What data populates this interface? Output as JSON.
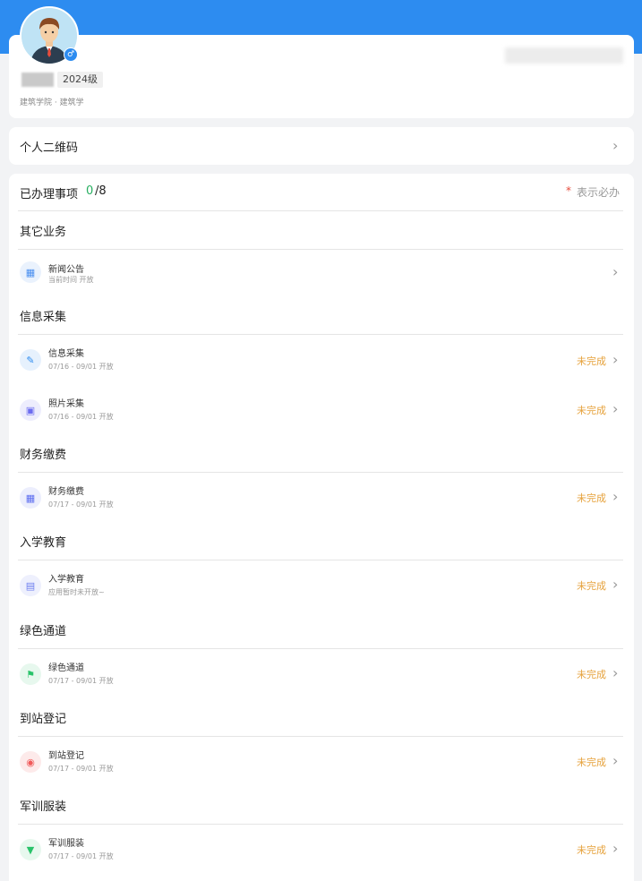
{
  "profile": {
    "grade": "2024级",
    "department": "建筑学院 · 建筑学",
    "gender_symbol": "♂"
  },
  "qr": {
    "label": "个人二维码"
  },
  "tasks": {
    "title": "已办理事项",
    "done": "0",
    "total": "/8",
    "required_mark": "*",
    "required_note": "表示必办"
  },
  "sections": [
    {
      "title": "其它业务",
      "items": [
        {
          "name": "新闻公告",
          "sub": "当前时间 开放",
          "status": "",
          "icon": "grid-icon",
          "color": "#4a8ff0",
          "bg": "#eaf2fd"
        }
      ]
    },
    {
      "title": "信息采集",
      "items": [
        {
          "name": "信息采集",
          "sub": "07/16 - 09/01 开放",
          "status": "未完成",
          "icon": "edit-icon",
          "color": "#2d8cf0",
          "bg": "#e6f1fd"
        },
        {
          "name": "照片采集",
          "sub": "07/16 - 09/01 开放",
          "status": "未完成",
          "icon": "image-icon",
          "color": "#6c6cf0",
          "bg": "#ededfd"
        }
      ]
    },
    {
      "title": "财务缴费",
      "items": [
        {
          "name": "财务缴费",
          "sub": "07/17 - 09/01 开放",
          "status": "未完成",
          "icon": "grid-icon",
          "color": "#5b6cf0",
          "bg": "#eceefd"
        }
      ]
    },
    {
      "title": "入学教育",
      "items": [
        {
          "name": "入学教育",
          "sub": "应用暂时未开放~",
          "status": "未完成",
          "icon": "book-icon",
          "color": "#6d7ef0",
          "bg": "#eef0fd"
        }
      ]
    },
    {
      "title": "绿色通道",
      "items": [
        {
          "name": "绿色通道",
          "sub": "07/17 - 09/01 开放",
          "status": "未完成",
          "icon": "flag-icon",
          "color": "#29c36a",
          "bg": "#e7f8ee"
        }
      ]
    },
    {
      "title": "到站登记",
      "items": [
        {
          "name": "到站登记",
          "sub": "07/17 - 09/01 开放",
          "status": "未完成",
          "icon": "map-pin-icon",
          "color": "#f05a5a",
          "bg": "#fdeaea"
        }
      ]
    },
    {
      "title": "军训服装",
      "items": [
        {
          "name": "军训服装",
          "sub": "07/17 - 09/01 开放",
          "status": "未完成",
          "icon": "shirt-icon",
          "color": "#29c36a",
          "bg": "#e7f8ee"
        }
      ]
    }
  ]
}
